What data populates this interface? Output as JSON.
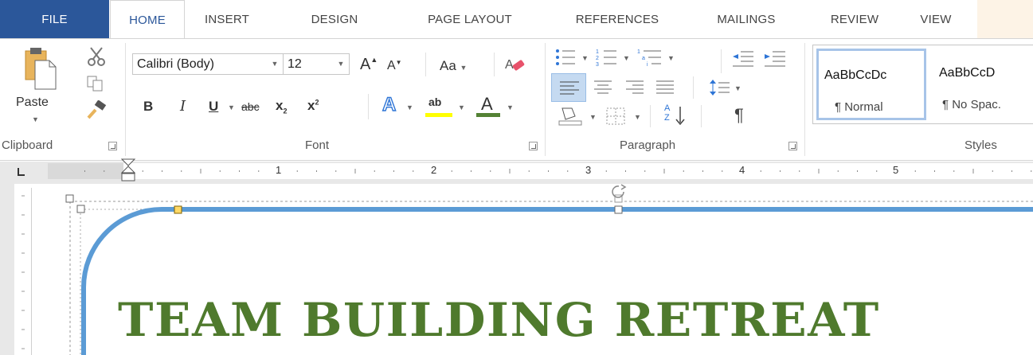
{
  "tabs": [
    "FILE",
    "HOME",
    "INSERT",
    "DESIGN",
    "PAGE LAYOUT",
    "REFERENCES",
    "MAILINGS",
    "REVIEW",
    "VIEW"
  ],
  "active_tab": "HOME",
  "clipboard": {
    "paste_label": "Paste",
    "group_label": "Clipboard"
  },
  "font": {
    "name": "Calibri (Body)",
    "size": "12",
    "grow_label": "A",
    "shrink_label": "A",
    "change_case_label": "Aa",
    "bold": "B",
    "italic": "I",
    "underline": "U",
    "strikethrough": "abc",
    "subscript": "x",
    "subscript_mark": "2",
    "superscript": "x",
    "superscript_mark": "2",
    "effects_label": "A",
    "highlight_label": "ab",
    "color_label": "A",
    "group_label": "Font"
  },
  "paragraph": {
    "sort_label": "A Z",
    "pilcrow": "¶",
    "group_label": "Paragraph"
  },
  "styles": {
    "items": [
      {
        "preview": "AaBbCcDc",
        "name": "¶ Normal"
      },
      {
        "preview": "AaBbCcD",
        "name": "¶ No Spac."
      }
    ],
    "group_label": "Styles"
  },
  "ruler": {
    "numbers": [
      "1",
      "2",
      "3",
      "4",
      "5"
    ]
  },
  "document": {
    "title": "TEAM BUILDING RETREAT"
  },
  "colors": {
    "file_tab": "#2b579a",
    "accent": "#2b579a",
    "title_text": "#4f7a2d",
    "shape_outline": "#5b9bd5",
    "highlight": "#ffff00",
    "font_color": "#548235"
  }
}
